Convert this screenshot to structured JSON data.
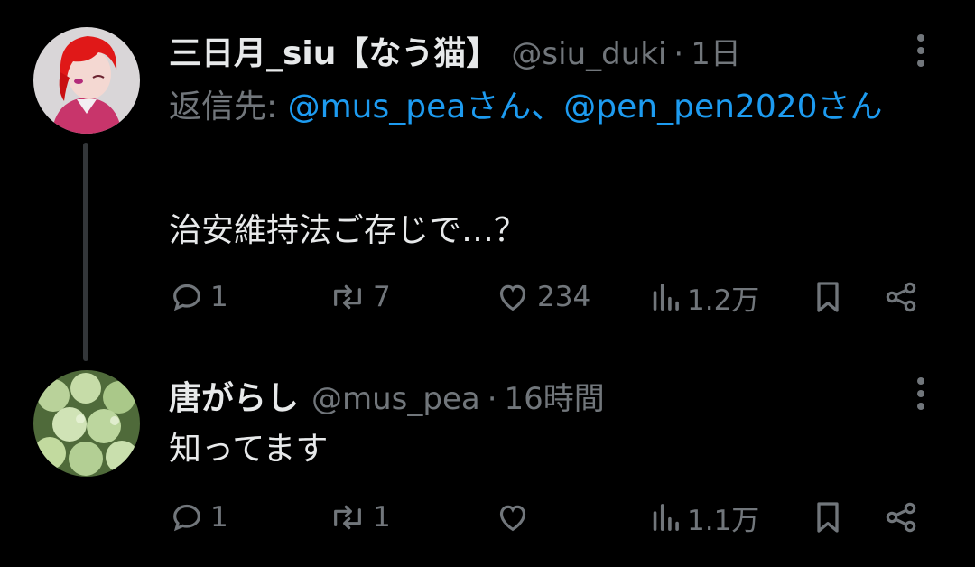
{
  "tweets": [
    {
      "display_name": "三日月_siu【なう猫】",
      "handle": "@siu_duki",
      "separator": "·",
      "time": "1日",
      "reply_to_prefix": "返信先: ",
      "reply_to_mention_1": "@mus_peaさん",
      "reply_to_joiner": "、",
      "reply_to_mention_2": "@pen_pen2020さん",
      "text": "治安維持法ご存じで…？",
      "replies": "1",
      "retweets": "7",
      "likes": "234",
      "views": "1.2万"
    },
    {
      "display_name": "唐がらし",
      "handle": "@mus_pea",
      "separator": "·",
      "time": "16時間",
      "text": "知ってます",
      "replies": "1",
      "retweets": "1",
      "likes": "",
      "views": "1.1万"
    }
  ],
  "colors": {
    "background": "#000000",
    "primary_text": "#e7e9ea",
    "secondary_text": "#71767b",
    "mention": "#1d9bf0"
  }
}
